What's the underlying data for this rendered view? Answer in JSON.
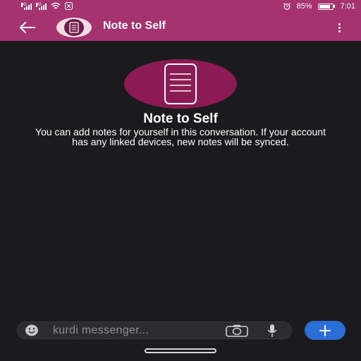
{
  "status_bar": {
    "signal_1_type": "4G",
    "signal_2_type": "4G",
    "battery_percent": "85%",
    "battery_level": 0.85,
    "time": "7:01"
  },
  "toolbar": {
    "title": "Note to Self"
  },
  "intro": {
    "title": "Note to Self",
    "body": "You can add notes for yourself in this conversation. If your account has any linked devices, new notes will be synced."
  },
  "compose": {
    "placeholder": "kurdi messenger..."
  },
  "colors": {
    "toolbar": "#a5336f",
    "avatar": "#8b1a55",
    "background": "#1b1b1d",
    "send_button": "#2b6fd6"
  },
  "icons": {
    "back": "arrow-left",
    "avatar": "note-document",
    "menu": "more-vertical",
    "emoji": "smiley-face",
    "camera": "camera",
    "mic": "microphone",
    "attach": "plus"
  }
}
